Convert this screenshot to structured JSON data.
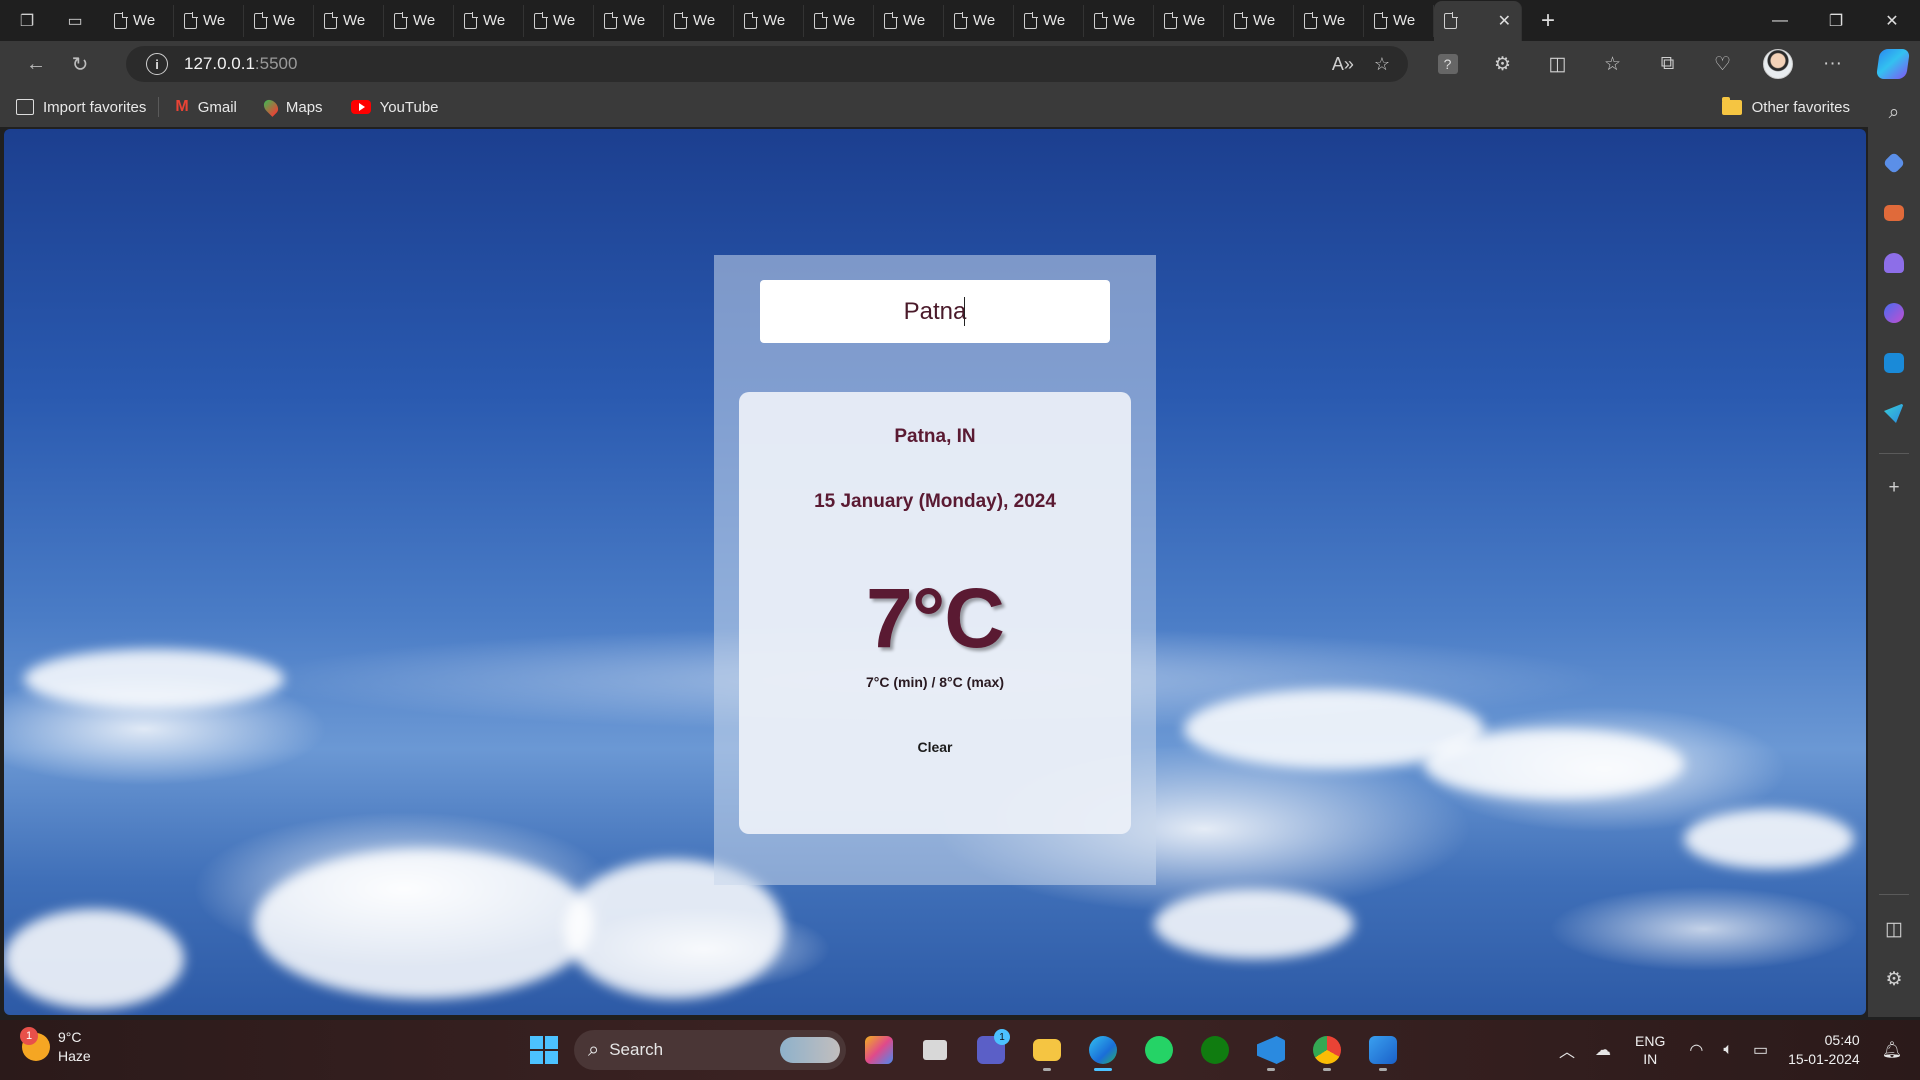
{
  "browser": {
    "tab_title": "We",
    "url_host": "127.0.0.1",
    "url_port": ":5500"
  },
  "favorites": {
    "import": "Import favorites",
    "gmail": "Gmail",
    "maps": "Maps",
    "youtube": "YouTube",
    "other": "Other favorites"
  },
  "weather_app": {
    "search_value": "Patna",
    "city": "Patna, IN",
    "date": "15 January (Monday), 2024",
    "temperature": "7°C",
    "min_max": "7°C (min) / 8°C (max)",
    "condition": "Clear"
  },
  "taskbar": {
    "weather_temp": "9°C",
    "weather_desc": "Haze",
    "weather_badge": "1",
    "search_label": "Search",
    "teams_badge": "1",
    "lang_top": "ENG",
    "lang_bottom": "IN",
    "time": "05:40",
    "date": "15-01-2024"
  },
  "colors": {
    "accent": "#4cc2ff",
    "text_maroon": "#5a1a32"
  }
}
